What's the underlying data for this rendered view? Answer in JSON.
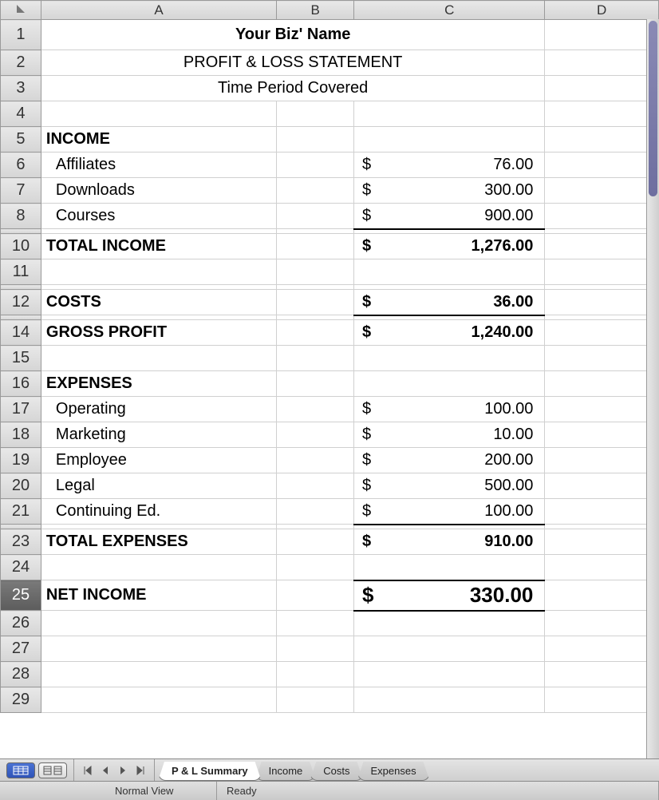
{
  "columns": [
    "A",
    "B",
    "C",
    "D"
  ],
  "header": {
    "biz_name": "Your Biz' Name",
    "subtitle": "PROFIT & LOSS STATEMENT",
    "period": "Time Period Covered"
  },
  "sections": {
    "income_label": "INCOME",
    "income_items": [
      {
        "name": "Affiliates",
        "amount": "76.00"
      },
      {
        "name": "Downloads",
        "amount": "300.00"
      },
      {
        "name": "Courses",
        "amount": "900.00"
      }
    ],
    "total_income_label": "TOTAL INCOME",
    "total_income": "1,276.00",
    "costs_label": "COSTS",
    "costs": "36.00",
    "gross_profit_label": "GROSS PROFIT",
    "gross_profit": "1,240.00",
    "expenses_label": "EXPENSES",
    "expense_items": [
      {
        "name": "Operating",
        "amount": "100.00"
      },
      {
        "name": "Marketing",
        "amount": "10.00"
      },
      {
        "name": "Employee",
        "amount": "200.00"
      },
      {
        "name": "Legal",
        "amount": "500.00"
      },
      {
        "name": "Continuing Ed.",
        "amount": "100.00"
      }
    ],
    "total_expenses_label": "TOTAL EXPENSES",
    "total_expenses": "910.00",
    "net_income_label": "NET INCOME",
    "net_income": "330.00"
  },
  "currency_sign": "$",
  "sheet_tabs": [
    "P & L Summary",
    "Income",
    "Costs",
    "Expenses"
  ],
  "active_tab": 0,
  "status": {
    "view": "Normal View",
    "state": "Ready"
  },
  "selected_row": 25,
  "row_numbers": [
    1,
    2,
    3,
    4,
    5,
    6,
    7,
    8,
    10,
    11,
    12,
    14,
    15,
    16,
    17,
    18,
    19,
    20,
    21,
    23,
    24,
    25,
    26,
    27,
    28,
    29
  ],
  "collapsed_before": [
    10,
    12,
    14,
    23
  ]
}
